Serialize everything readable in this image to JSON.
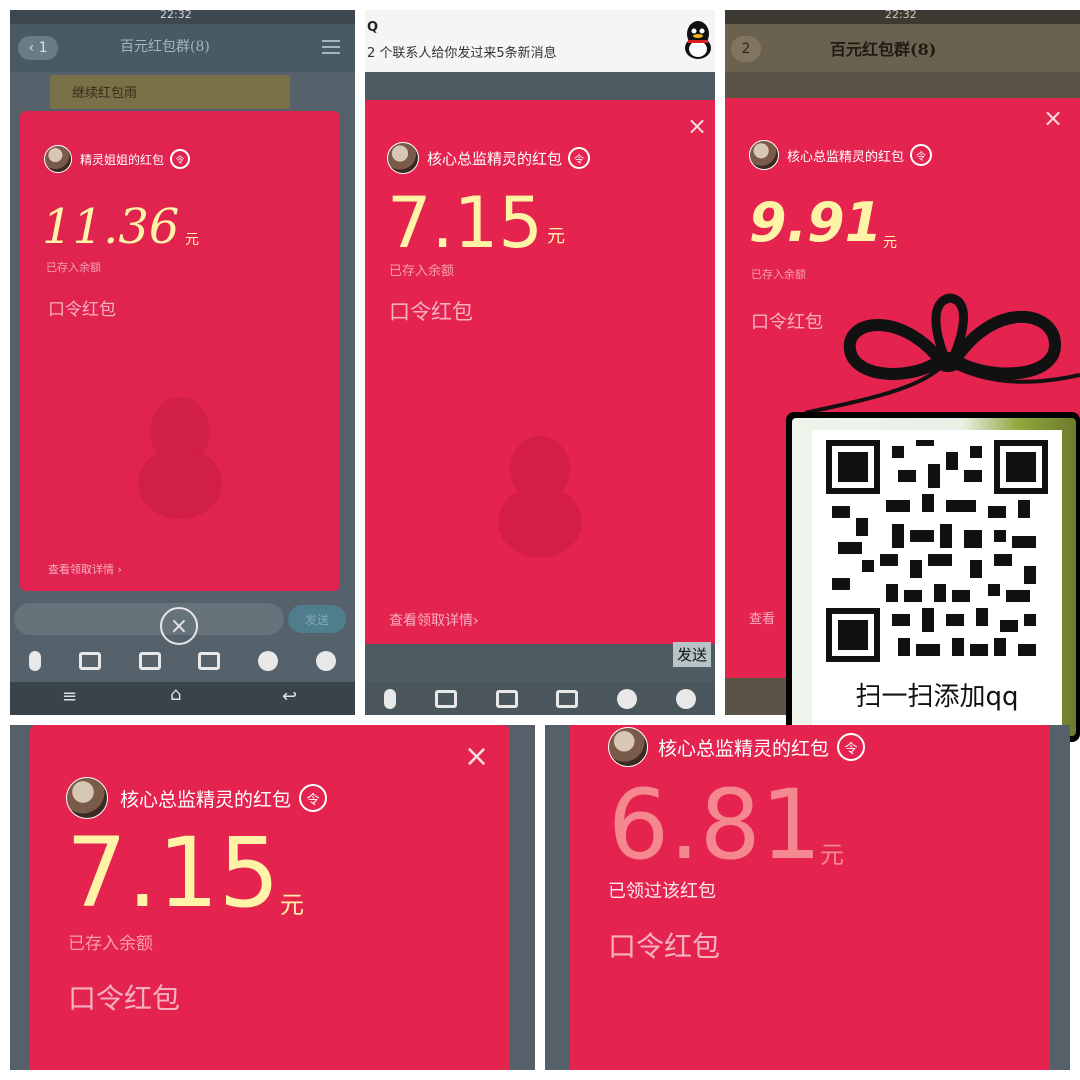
{
  "panel1": {
    "title": "百元红包群(8)",
    "back_badge": "1",
    "banner": "继续红包雨",
    "sender": "精灵姐姐的红包",
    "ling_icon": "令",
    "amount": "11.36",
    "unit": "元",
    "status": "已存入余额",
    "type": "口令红包",
    "details": "查看领取详情",
    "send_button": "发送",
    "status_bar_time": "22:32"
  },
  "panel2": {
    "notif_app": "Q",
    "notif_text": "2 个联系人给你发过来5条新消息",
    "sender": "核心总监精灵的红包",
    "ling_icon": "令",
    "amount": "7.15",
    "unit": "元",
    "status": "已存入余额",
    "type": "口令红包",
    "details": "查看领取详情",
    "send_button": "发送"
  },
  "panel3": {
    "title": "百元红包群(8)",
    "back_badge": "2",
    "status_bar_time": "22:32",
    "sender": "核心总监精灵的红包",
    "ling_icon": "令",
    "amount": "9.91",
    "unit": "元",
    "status": "已存入余额",
    "type": "口令红包",
    "details": "查看",
    "qr_caption": "扫一扫添加qq"
  },
  "panel4": {
    "sender": "核心总监精灵的红包",
    "ling_icon": "令",
    "amount": "7.15",
    "unit": "元",
    "status": "已存入余额",
    "type": "口令红包"
  },
  "panel5": {
    "sender": "核心总监精灵的红包",
    "ling_icon": "令",
    "amount": "6.81",
    "unit": "元",
    "status": "已领过该红包",
    "type": "口令红包"
  },
  "icons": [
    "back-icon",
    "menu-icon",
    "close-icon",
    "ling-icon",
    "penguin-icon",
    "mic-icon",
    "image-icon",
    "camera-icon",
    "red-packet-icon",
    "emoji-icon",
    "plus-icon",
    "home-icon",
    "back-nav-icon",
    "qq-logo-icon",
    "bow-icon",
    "qr-code-icon"
  ],
  "colors": {
    "card_red": "#e4234f",
    "amount_yellow": "#fff3a8",
    "faded_amount": "#f5878f",
    "overlay": "#5b6670"
  }
}
